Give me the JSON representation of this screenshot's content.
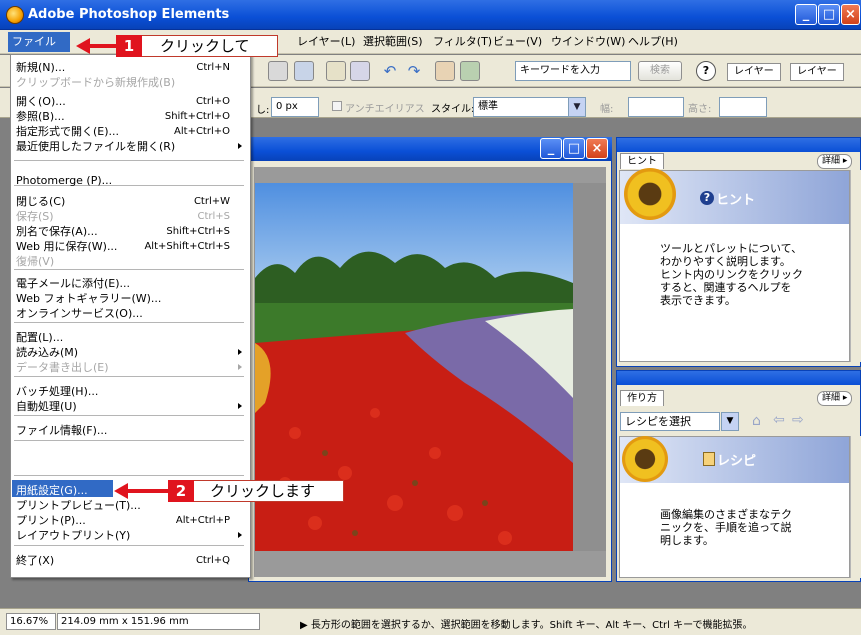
{
  "window": {
    "title": "Adobe Photoshop Elements",
    "minimize_glyph": "_",
    "maximize_glyph": "□",
    "close_glyph": "×"
  },
  "menubar": {
    "items": [
      "ファイル(F)",
      "レイヤー(L)",
      "選択範囲(S)",
      "フィルタ(T)",
      "ビュー(V)",
      "ウインドウ(W)",
      "ヘルプ(H)"
    ]
  },
  "toolbar": {
    "search_placeholder": "キーワードを入力",
    "search_button": "検索",
    "layer_tabs": [
      "レイヤー",
      "レイヤー"
    ],
    "feather_label": "し:",
    "feather_value": "0 px",
    "antialias_label": "アンチエイリアス",
    "style_label": "スタイル:",
    "style_value": "標準",
    "width_label": "幅:",
    "height_label": "高さ:"
  },
  "file_menu": {
    "items": [
      {
        "label": "新規(N)...",
        "shortcut": "Ctrl+N",
        "disabled": false
      },
      {
        "label": "クリップボードから新規作成(B)",
        "shortcut": "",
        "disabled": true
      },
      {
        "label": "開く(O)...",
        "shortcut": "Ctrl+O",
        "disabled": false
      },
      {
        "label": "参照(B)...",
        "shortcut": "Shift+Ctrl+O",
        "disabled": false
      },
      {
        "label": "指定形式で開く(E)...",
        "shortcut": "Alt+Ctrl+O",
        "disabled": false
      },
      {
        "label": "最近使用したファイルを開く(R)",
        "shortcut": "",
        "disabled": false,
        "submenu": true
      },
      {
        "label": "Photomerge (P)...",
        "shortcut": "",
        "disabled": false
      },
      {
        "label": "閉じる(C)",
        "shortcut": "Ctrl+W",
        "disabled": false
      },
      {
        "label": "保存(S)",
        "shortcut": "Ctrl+S",
        "disabled": true
      },
      {
        "label": "別名で保存(A)...",
        "shortcut": "Shift+Ctrl+S",
        "disabled": false
      },
      {
        "label": "Web 用に保存(W)...",
        "shortcut": "Alt+Shift+Ctrl+S",
        "disabled": false
      },
      {
        "label": "復帰(V)",
        "shortcut": "",
        "disabled": true
      },
      {
        "label": "電子メールに添付(E)...",
        "shortcut": "",
        "disabled": false
      },
      {
        "label": "Web フォトギャラリー(W)...",
        "shortcut": "",
        "disabled": false
      },
      {
        "label": "オンラインサービス(O)...",
        "shortcut": "",
        "disabled": false
      },
      {
        "label": "配置(L)...",
        "shortcut": "",
        "disabled": false
      },
      {
        "label": "読み込み(M)",
        "shortcut": "",
        "disabled": false,
        "submenu": true
      },
      {
        "label": "データ書き出し(E)",
        "shortcut": "",
        "disabled": true,
        "submenu": true
      },
      {
        "label": "バッチ処理(H)...",
        "shortcut": "",
        "disabled": false
      },
      {
        "label": "自動処理(U)",
        "shortcut": "",
        "disabled": false,
        "submenu": true
      },
      {
        "label": "ファイル情報(F)...",
        "shortcut": "",
        "disabled": false
      },
      {
        "label": "用紙設定(G)...",
        "shortcut": "",
        "disabled": false,
        "highlighted": true
      },
      {
        "label": "プリントプレビュー(T)...",
        "shortcut": "",
        "disabled": false
      },
      {
        "label": "プリント(P)...",
        "shortcut": "Alt+Ctrl+P",
        "disabled": false
      },
      {
        "label": "レイアウトプリント(Y)",
        "shortcut": "",
        "disabled": false,
        "submenu": true
      },
      {
        "label": "終了(X)",
        "shortcut": "Ctrl+Q",
        "disabled": false
      }
    ]
  },
  "callouts": [
    {
      "number": "1",
      "text": "クリックして"
    },
    {
      "number": "2",
      "text": "クリックします"
    }
  ],
  "hint_palette": {
    "tab": "ヒント",
    "more": "詳細 ▸",
    "header": "ヒント",
    "text": "ツールとパレットについて、\nわかりやすく説明します。\nヒント内のリンクをクリック\nすると、関連するヘルプを\n表示できます。"
  },
  "recipe_palette": {
    "tab": "作り方",
    "more": "詳細 ▸",
    "select_value": "レシピを選択",
    "header": "レシピ",
    "text": "画像編集のさまざまなテク\nニックを、手順を追って説\n明します。"
  },
  "statusbar": {
    "zoom": "16.67%",
    "size": "214.09 mm x 151.96 mm",
    "message": "▶ 長方形の範囲を選択するか、選択範囲を移動します。Shift キー、Alt キー、Ctrl キーで機能拡張。"
  },
  "colors": {
    "accent": "#316ac5",
    "callout_red": "#e0141e",
    "titlebar": "#0a4fd6"
  }
}
